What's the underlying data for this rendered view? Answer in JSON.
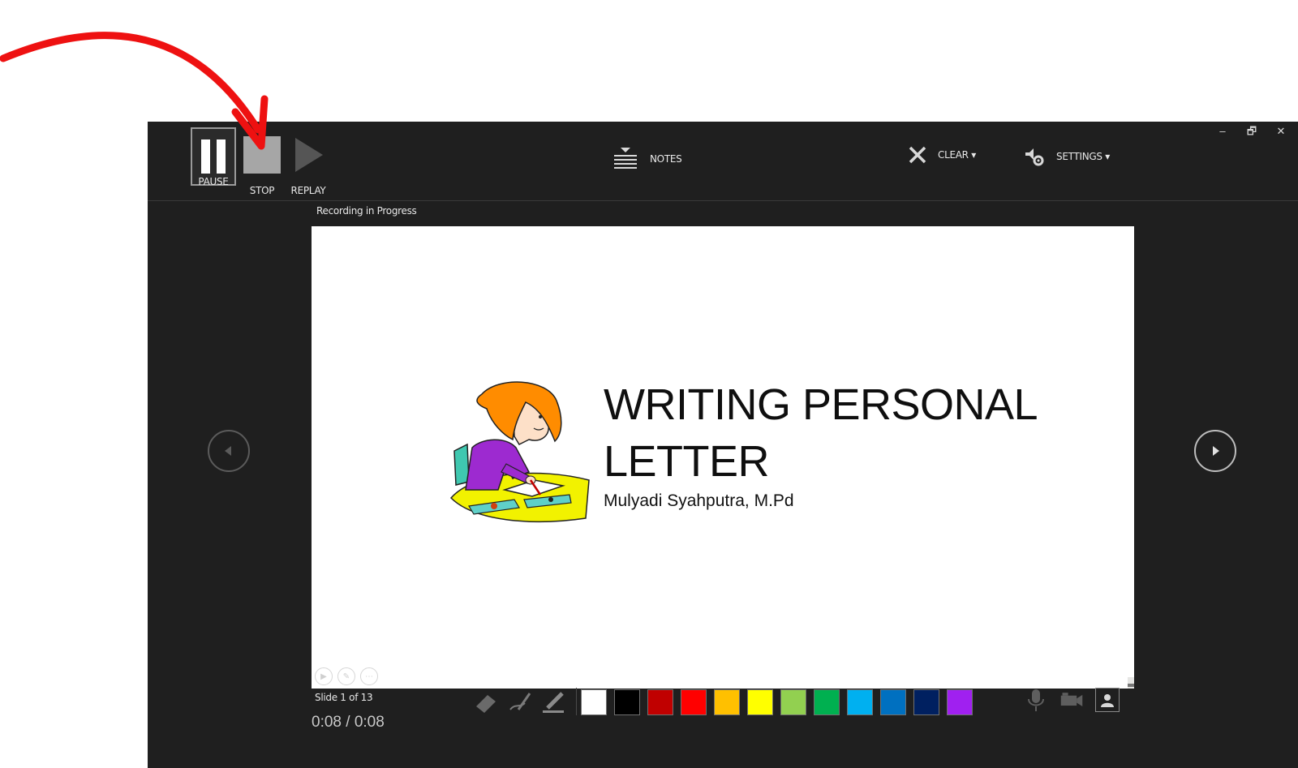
{
  "toolbar": {
    "pause_label": "PAUSE",
    "stop_label": "STOP",
    "replay_label": "REPLAY",
    "notes_label": "NOTES",
    "clear_label": "CLEAR ▾",
    "settings_label": "SETTINGS ▾"
  },
  "window_controls": {
    "minimize": "–",
    "restore": "🗗",
    "close": "✕"
  },
  "status": {
    "recording": "Recording in Progress"
  },
  "slide": {
    "title_line1": "WRITING PERSONAL",
    "title_line2": "LETTER",
    "subtitle": "Mulyadi Syahputra, M.Pd"
  },
  "footer": {
    "slide_counter": "Slide 1 of 13",
    "timer_current": "0:08",
    "timer_separator": "/",
    "timer_total": "0:08"
  },
  "pen_tools": [
    "eraser-icon",
    "pen-icon",
    "highlighter-icon"
  ],
  "ink_colors": [
    "#ffffff",
    "#000000",
    "#c00000",
    "#ff0000",
    "#ffc000",
    "#ffff00",
    "#92d050",
    "#00b050",
    "#00b0f0",
    "#0070c0",
    "#002060",
    "#a020f0"
  ],
  "annotation": {
    "arrow_color": "#ee1111"
  }
}
